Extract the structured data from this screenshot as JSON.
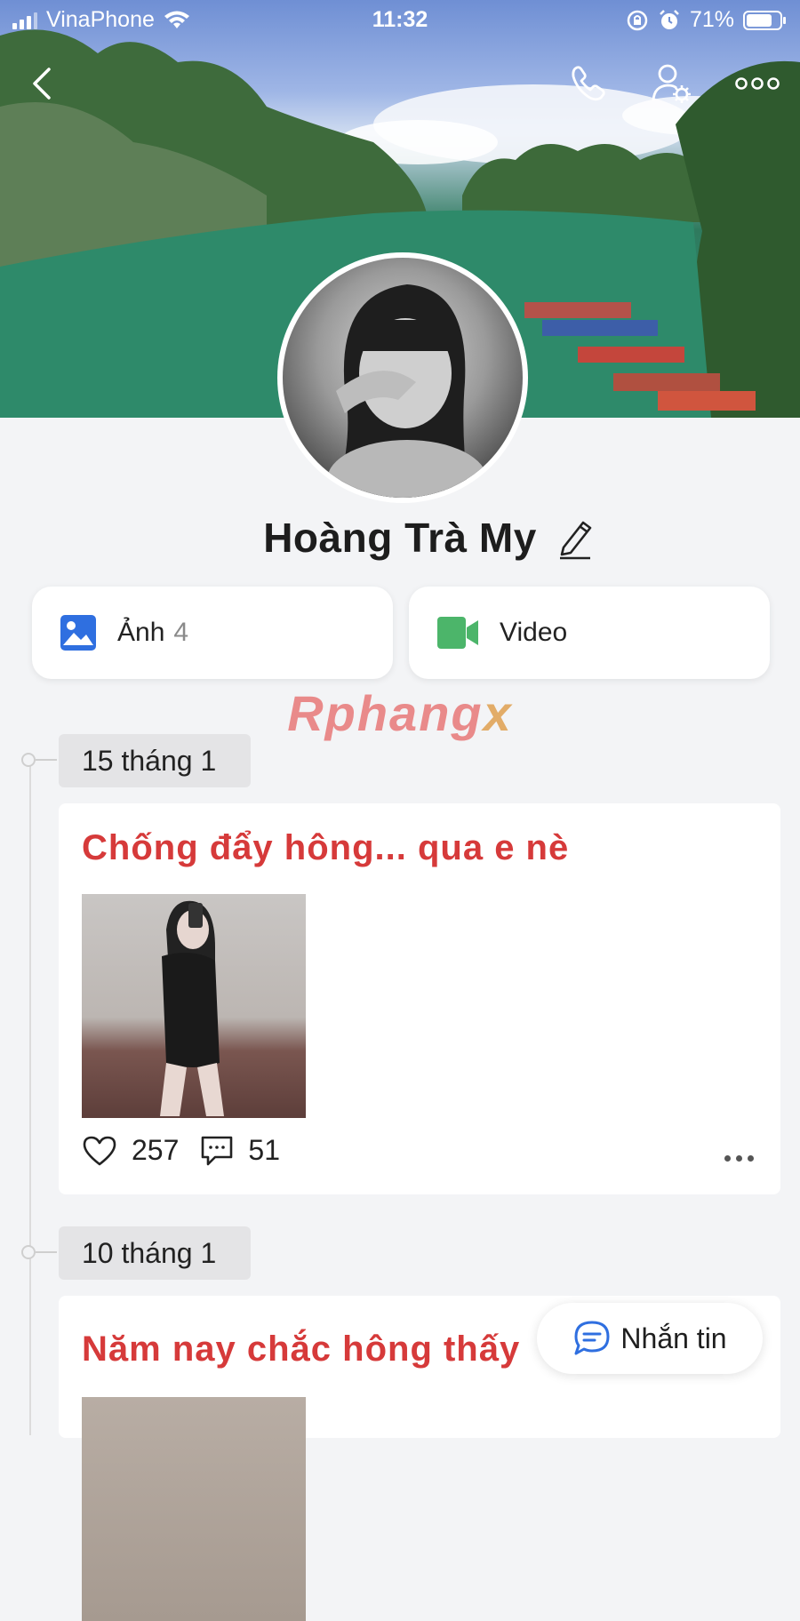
{
  "status_bar": {
    "carrier": "VinaPhone",
    "time": "11:32",
    "battery": "71%"
  },
  "profile": {
    "name": "Hoàng Trà My"
  },
  "media": {
    "photos_label": "Ảnh",
    "photos_count": "4",
    "video_label": "Video"
  },
  "watermark": {
    "text": "Rphang",
    "x": "x"
  },
  "timeline": [
    {
      "date": "15 tháng 1",
      "caption": "Chống đẩy hông... qua e nè",
      "likes": "257",
      "comments": "51"
    },
    {
      "date": "10 tháng 1",
      "caption": "Năm nay chắc hông thấy"
    }
  ],
  "message_button": {
    "label": "Nhắn tin"
  },
  "colors": {
    "caption_red": "#d63a3a",
    "photo_icon_blue": "#2f6fe0",
    "video_icon_green": "#4cb56a",
    "message_icon_blue": "#2f6fe0"
  }
}
